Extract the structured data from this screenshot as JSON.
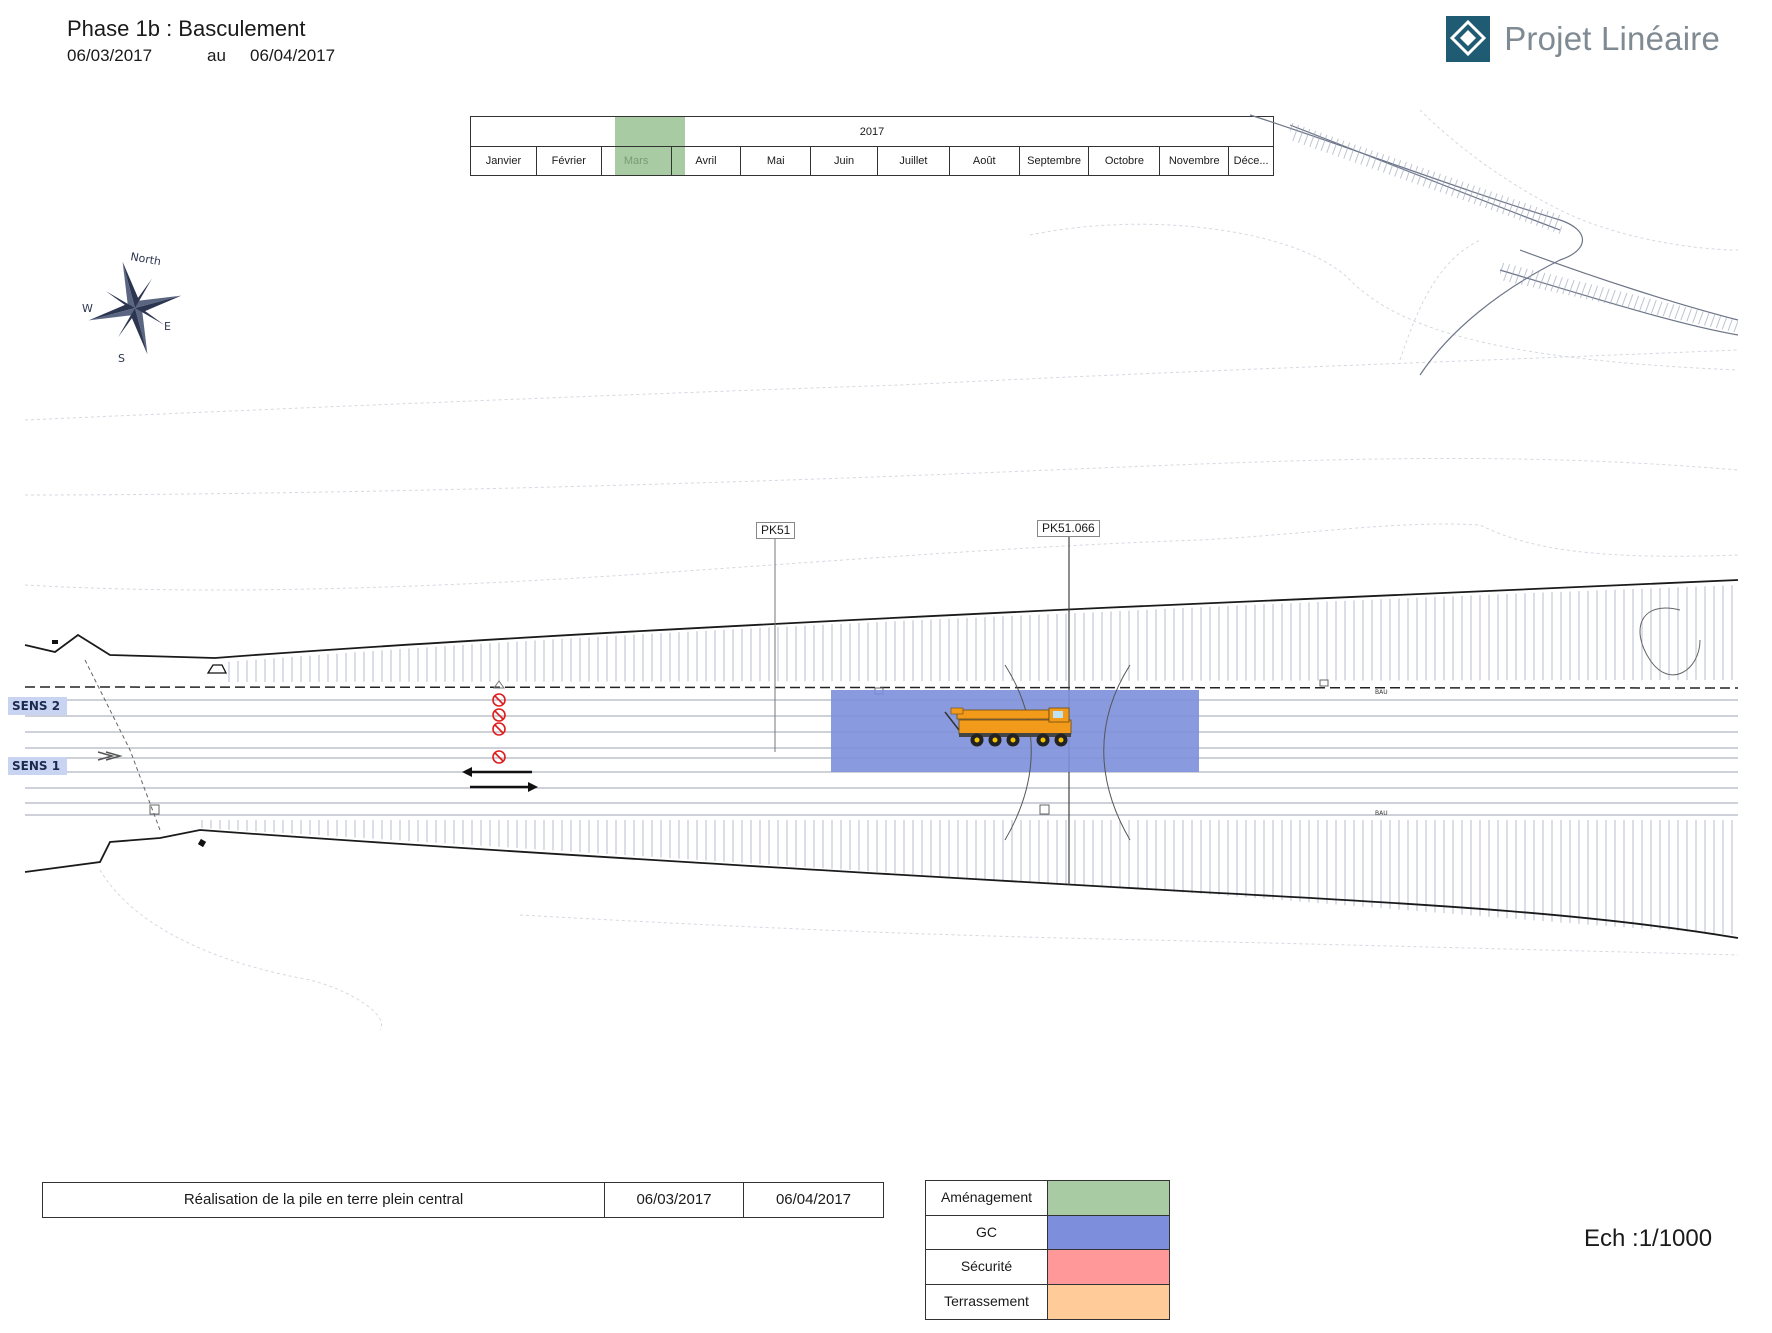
{
  "header": {
    "title": "Phase 1b : Basculement",
    "date_start": "06/03/2017",
    "date_sep": "au",
    "date_end": "06/04/2017"
  },
  "logo": {
    "text": "Projet Linéaire",
    "icon": "diamond-logo-icon",
    "color": "#1f5c74"
  },
  "timeline": {
    "year": "2017",
    "months": [
      "Janvier",
      "Février",
      "Mars",
      "Avril",
      "Mai",
      "Juin",
      "Juillet",
      "Août",
      "Septembre",
      "Octobre",
      "Novembre",
      "Déce..."
    ],
    "highlighted_month": "Mars",
    "highlight_color": "#a8cba4"
  },
  "compass": {
    "north": "North",
    "west": "W",
    "east": "E",
    "south": "S"
  },
  "plan": {
    "sens_2": "SENS 2",
    "sens_1": "SENS 1",
    "pk_a": "PK51",
    "pk_b": "PK51.066",
    "bau_top": "BAU",
    "bau_bottom": "BAU",
    "work_zone_color": "#7d8fdc",
    "no_entry_count": 4
  },
  "task": {
    "label": "Réalisation de la pile en terre plein central",
    "start": "06/03/2017",
    "end": "06/04/2017"
  },
  "legend": [
    {
      "label": "Aménagement",
      "color": "#a8cba4"
    },
    {
      "label": "GC",
      "color": "#7d8fdc"
    },
    {
      "label": "Sécurité",
      "color": "#ff9999"
    },
    {
      "label": "Terrassement",
      "color": "#ffcc99"
    }
  ],
  "scale": "Ech :1/1000"
}
